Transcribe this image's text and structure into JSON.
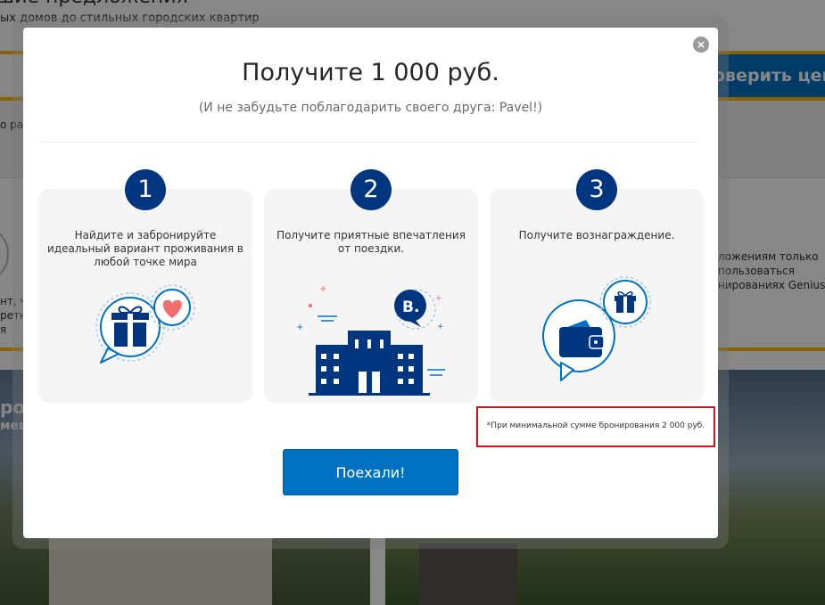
{
  "background": {
    "title": "шие предложения",
    "subtitle": "ых домов до стильных городских квартир",
    "check_prices_label": "оверить цены",
    "left_fragment": "о ра",
    "genius_lines": [
      "ложениям только",
      "пользоваться",
      "нированиях Genius."
    ],
    "left_lines": [
      "нт, ч",
      "ретн",
      "я"
    ],
    "photo_text_1": "ро",
    "photo_text_2": "мещ"
  },
  "modal": {
    "close_label": "×",
    "title": "Получите 1 000 руб.",
    "subtitle": "(И не забудьте поблагодарить своего друга: Pavel!)",
    "steps": [
      {
        "number": "1",
        "text": "Найдите и забронируйте идеальный вариант проживания в любой точке мира",
        "icon": "gift-heart-icon"
      },
      {
        "number": "2",
        "text": "Получите приятные впечатления от поездки.",
        "icon": "hotel-building-icon"
      },
      {
        "number": "3",
        "text": "Получите вознаграждение.",
        "icon": "wallet-gift-icon"
      }
    ],
    "booking_badge": "B.",
    "note": "*При минимальной сумме бронирования 2 000 руб.",
    "go_button": "Поехали!"
  },
  "colors": {
    "brand_blue": "#003580",
    "button_blue": "#0071c2",
    "accent_yellow": "#febb02",
    "highlight_red": "#d2121b",
    "heart": "#f26d6d"
  }
}
